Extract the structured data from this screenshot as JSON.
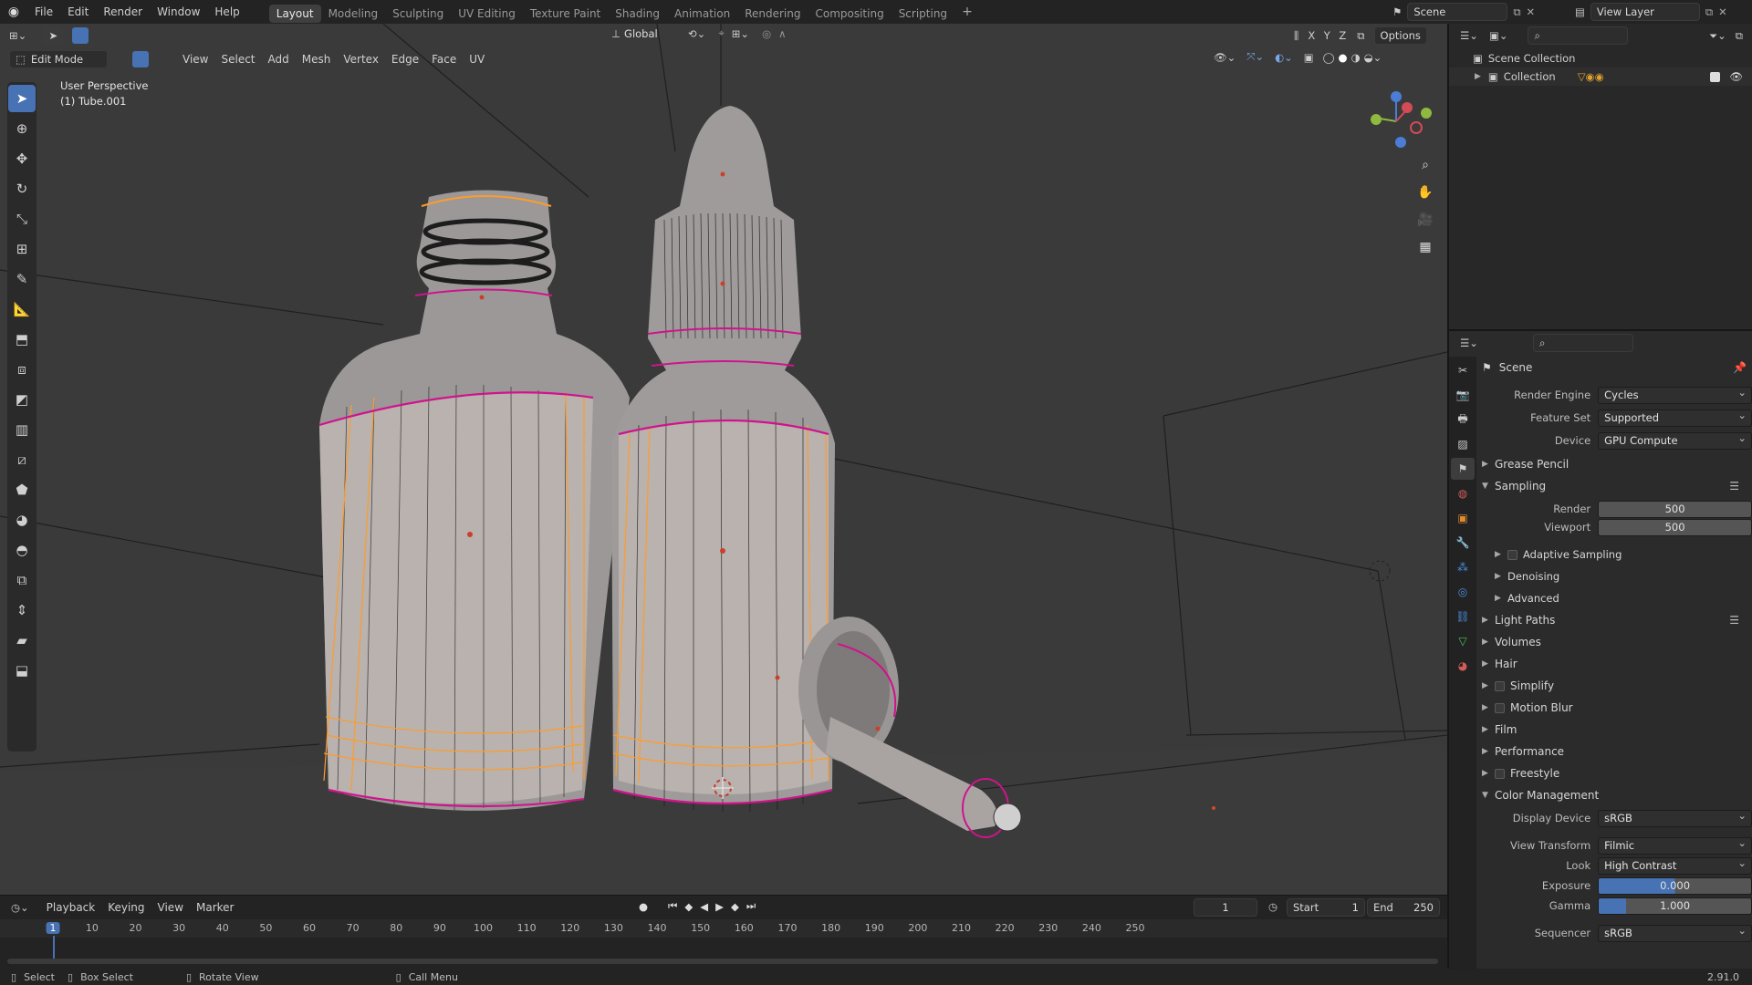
{
  "menu": {
    "items": [
      "File",
      "Edit",
      "Render",
      "Window",
      "Help"
    ]
  },
  "workspaces": [
    "Layout",
    "Modeling",
    "Sculpting",
    "UV Editing",
    "Texture Paint",
    "Shading",
    "Animation",
    "Rendering",
    "Compositing",
    "Scripting"
  ],
  "active_workspace": "Layout",
  "scene_name": "Scene",
  "view_layer": "View Layer",
  "viewport": {
    "mode": "Edit Mode",
    "header_menus": [
      "View",
      "Select",
      "Add",
      "Mesh",
      "Vertex",
      "Edge",
      "Face",
      "UV"
    ],
    "transform_orientation": "Global",
    "options_label": "Options",
    "axis_labels": [
      "X",
      "Y",
      "Z"
    ],
    "overlay_title": "User Perspective",
    "overlay_object": "(1) Tube.001"
  },
  "timeline": {
    "menus": [
      "Playback",
      "Keying",
      "View",
      "Marker"
    ],
    "current_frame": "1",
    "start_label": "Start",
    "start_value": "1",
    "end_label": "End",
    "end_value": "250",
    "ticks": [
      "1",
      "10",
      "20",
      "30",
      "40",
      "50",
      "60",
      "70",
      "80",
      "90",
      "100",
      "110",
      "120",
      "130",
      "140",
      "150",
      "160",
      "170",
      "180",
      "190",
      "200",
      "210",
      "220",
      "230",
      "240",
      "250"
    ]
  },
  "statusbar": {
    "select": "Select",
    "box_select": "Box Select",
    "rotate_view": "Rotate View",
    "call_menu": "Call Menu",
    "version": "2.91.0"
  },
  "outliner": {
    "root": "Scene Collection",
    "collection": "Collection"
  },
  "properties": {
    "context": "Scene",
    "render_engine": {
      "label": "Render Engine",
      "value": "Cycles"
    },
    "feature_set": {
      "label": "Feature Set",
      "value": "Supported"
    },
    "device": {
      "label": "Device",
      "value": "GPU Compute"
    },
    "grease_pencil": "Grease Pencil",
    "sampling": "Sampling",
    "render_samples": {
      "label": "Render",
      "value": "500"
    },
    "viewport_samples": {
      "label": "Viewport",
      "value": "500"
    },
    "adaptive_sampling": "Adaptive Sampling",
    "denoising": "Denoising",
    "advanced": "Advanced",
    "light_paths": "Light Paths",
    "volumes": "Volumes",
    "hair": "Hair",
    "simplify": "Simplify",
    "motion_blur": "Motion Blur",
    "film": "Film",
    "performance": "Performance",
    "freestyle": "Freestyle",
    "color_management": "Color Management",
    "display_device": {
      "label": "Display Device",
      "value": "sRGB"
    },
    "view_transform": {
      "label": "View Transform",
      "value": "Filmic"
    },
    "look": {
      "label": "Look",
      "value": "High Contrast"
    },
    "exposure": {
      "label": "Exposure",
      "value": "0.000"
    },
    "gamma": {
      "label": "Gamma",
      "value": "1.000"
    },
    "sequencer": {
      "label": "Sequencer",
      "value": "sRGB"
    }
  },
  "colors": {
    "accent": "#4772b3",
    "selected_edge": "#ff9c2a",
    "seam_edge": "#d0138c"
  }
}
